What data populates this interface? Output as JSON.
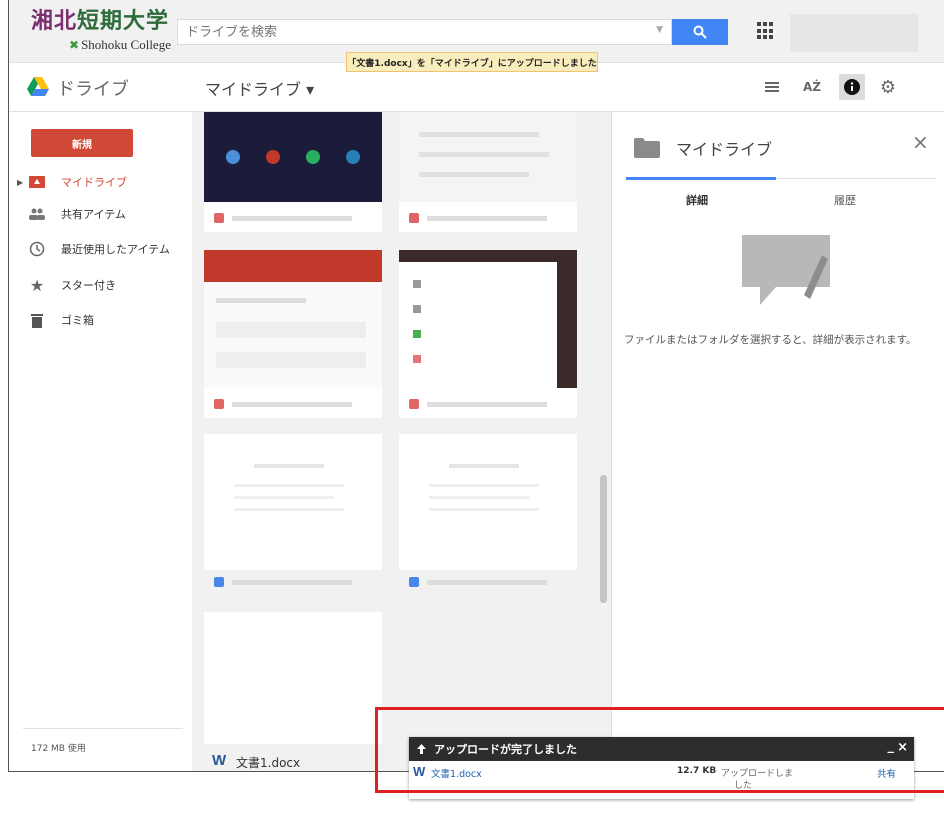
{
  "header": {
    "logo_jp_a": "湘北",
    "logo_jp_b": "短期大学",
    "logo_en": "Shohoku College",
    "search_placeholder": "ドライブを検索",
    "toast": "「文書1.docx」を「マイドライブ」にアップロードしました"
  },
  "toolbar": {
    "drive_title": "ドライブ",
    "location": "マイドライブ ▾"
  },
  "sidebar": {
    "new_label": "新規",
    "items": [
      {
        "label": "マイドライブ",
        "icon": "drive-folder-icon"
      },
      {
        "label": "共有アイテム",
        "icon": "people-icon"
      },
      {
        "label": "最近使用したアイテム",
        "icon": "clock-icon"
      },
      {
        "label": "スター付き",
        "icon": "star-icon"
      },
      {
        "label": "ゴミ箱",
        "icon": "trash-icon"
      }
    ],
    "quota": "172 MB 使用"
  },
  "grid": {
    "new_file_name": "文書1.docx"
  },
  "details": {
    "title": "マイドライブ",
    "tab_details": "詳細",
    "tab_activity": "履歴",
    "message": "ファイルまたはフォルダを選択すると、詳細が表示されます。"
  },
  "upload": {
    "header": "アップロードが完了しました",
    "minimize": "_",
    "close": "×",
    "file_name": "文書1.docx",
    "size": "12.7 KB",
    "status_line1": "アップロードしま",
    "status_line2": "した",
    "share": "共有"
  },
  "colors": {
    "accent_red": "#d14836",
    "accent_blue": "#4285f4",
    "highlight_box": "#e02020"
  }
}
